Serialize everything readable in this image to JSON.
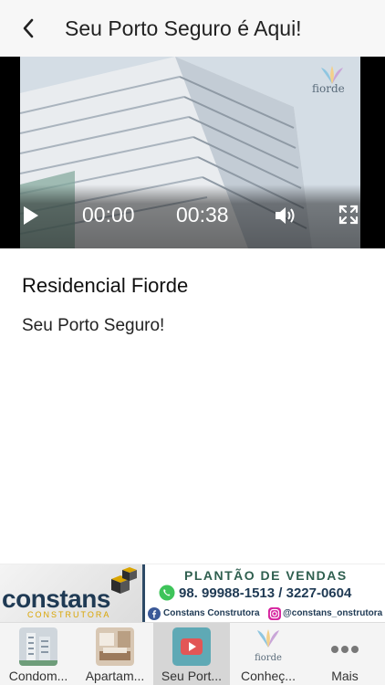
{
  "header": {
    "title": "Seu Porto Seguro é Aqui!",
    "back_icon": "chevron-left-icon"
  },
  "video": {
    "current_time": "00:00",
    "duration": "00:38",
    "progress": 0,
    "logo_text": "fiorde"
  },
  "content": {
    "title": "Residencial Fiorde",
    "body": "Seu Porto Seguro!"
  },
  "banner": {
    "brand": "constans",
    "brand_sub": "CONSTRUTORA",
    "headline": "PLANTÃO DE VENDAS",
    "phone": "98. 99988-1513 / 3227-0604",
    "facebook": "Constans Construtora",
    "instagram": "@constans_onstrutora",
    "colors": {
      "navy": "#1f3a54",
      "green": "#2f5f4f",
      "gold": "#d9a400"
    }
  },
  "tabs": [
    {
      "label": "Condom...",
      "icon": "building-thumbnail-icon",
      "active": false
    },
    {
      "label": "Apartam...",
      "icon": "apartment-thumbnail-icon",
      "active": false
    },
    {
      "label": "Seu Port...",
      "icon": "video-play-icon",
      "active": true
    },
    {
      "label": "Conheç...",
      "icon": "fiorde-logo-icon",
      "active": false
    },
    {
      "label": "Mais",
      "icon": "more-dots-icon",
      "active": false
    }
  ]
}
